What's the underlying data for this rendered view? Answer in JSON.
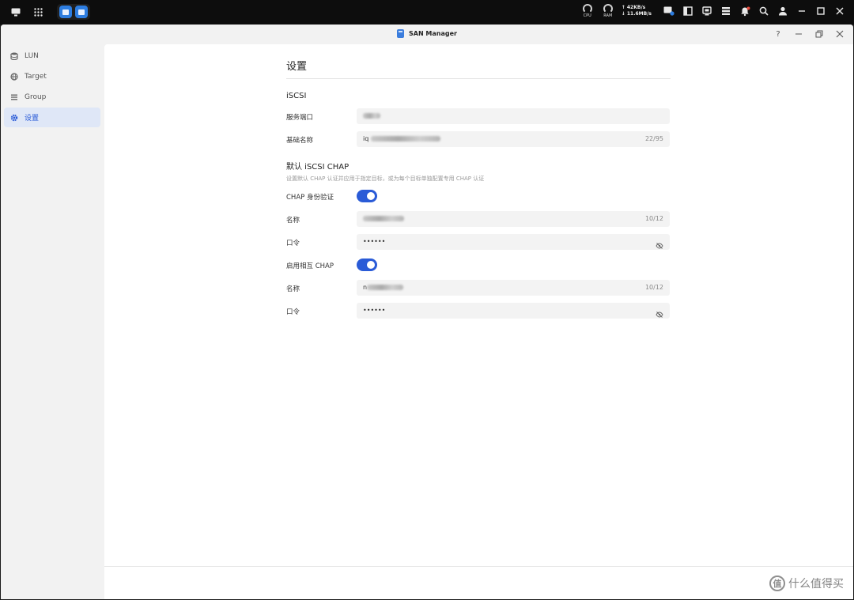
{
  "system_bar": {
    "cpu_label": "CPU",
    "ram_label": "RAM",
    "upload_speed": "↑ 42KB/s",
    "download_speed": "↓ 11.6MB/s"
  },
  "window": {
    "title": "SAN Manager",
    "help_label": "?"
  },
  "sidebar": {
    "items": [
      {
        "label": "LUN",
        "icon": "database-icon"
      },
      {
        "label": "Target",
        "icon": "globe-icon"
      },
      {
        "label": "Group",
        "icon": "list-icon"
      },
      {
        "label": "设置",
        "icon": "gear-icon",
        "active": true
      }
    ]
  },
  "settings": {
    "page_title": "设置",
    "iscsi": {
      "section_title": "iSCSI",
      "service_port_label": "服务端口",
      "base_name_label": "基础名称",
      "base_name_prefix": "iq",
      "base_name_count": "22/95"
    },
    "chap": {
      "section_title": "默认 iSCSI CHAP",
      "description": "设置默认 CHAP 认证并应用于指定目标，或为每个目标单独配置专用 CHAP 认证",
      "auth_label": "CHAP 身份验证",
      "auth_enabled": true,
      "name_label": "名称",
      "name_count": "10/12",
      "password_label": "口令",
      "password_value": "••••••"
    },
    "mutual_chap": {
      "enable_label": "启用相互 CHAP",
      "enabled": true,
      "name_label": "名称",
      "name_prefix": "n",
      "name_count": "10/12",
      "password_label": "口令",
      "password_value": "••••••"
    }
  },
  "watermark": {
    "circle_text": "值",
    "text": "什么值得买"
  },
  "colors": {
    "accent": "#2a5bd7",
    "sidebar_active_bg": "#dfe7f7",
    "topbar_bg": "#0d0d0d"
  }
}
